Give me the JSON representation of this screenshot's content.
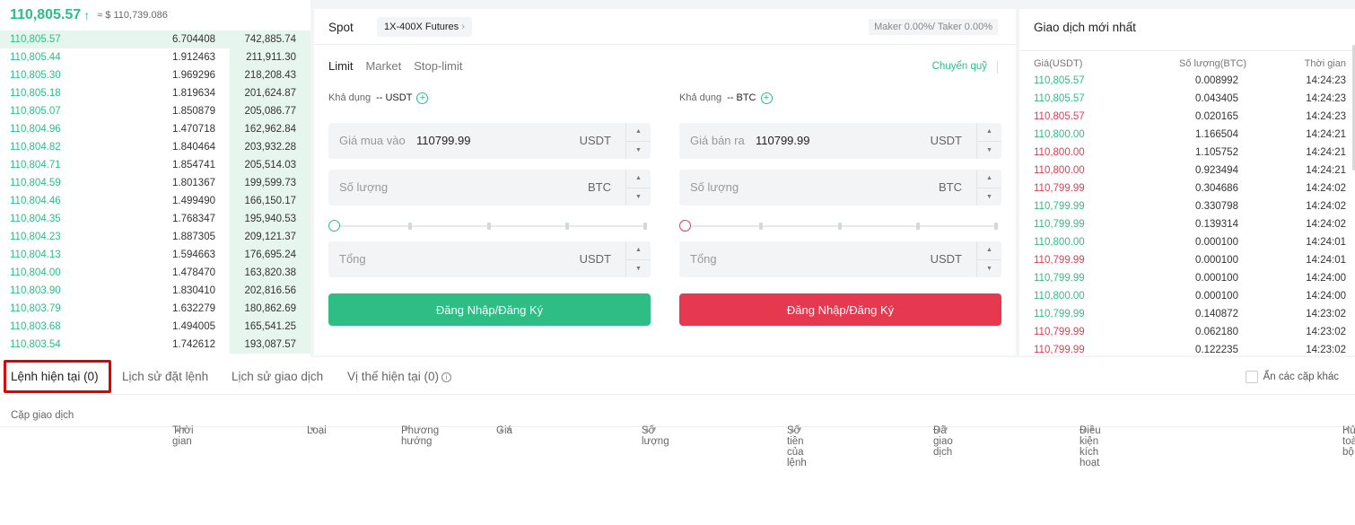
{
  "order_book": {
    "last_price": "110,805.57",
    "last_price_usd": "≈ $ 110,739.086",
    "rows": [
      {
        "price": "110,805.57",
        "amount": "6.704408",
        "total": "742,885.74"
      },
      {
        "price": "110,805.44",
        "amount": "1.912463",
        "total": "211,911.30"
      },
      {
        "price": "110,805.30",
        "amount": "1.969296",
        "total": "218,208.43"
      },
      {
        "price": "110,805.18",
        "amount": "1.819634",
        "total": "201,624.87"
      },
      {
        "price": "110,805.07",
        "amount": "1.850879",
        "total": "205,086.77"
      },
      {
        "price": "110,804.96",
        "amount": "1.470718",
        "total": "162,962.84"
      },
      {
        "price": "110,804.82",
        "amount": "1.840464",
        "total": "203,932.28"
      },
      {
        "price": "110,804.71",
        "amount": "1.854741",
        "total": "205,514.03"
      },
      {
        "price": "110,804.59",
        "amount": "1.801367",
        "total": "199,599.73"
      },
      {
        "price": "110,804.46",
        "amount": "1.499490",
        "total": "166,150.17"
      },
      {
        "price": "110,804.35",
        "amount": "1.768347",
        "total": "195,940.53"
      },
      {
        "price": "110,804.23",
        "amount": "1.887305",
        "total": "209,121.37"
      },
      {
        "price": "110,804.13",
        "amount": "1.594663",
        "total": "176,695.24"
      },
      {
        "price": "110,804.00",
        "amount": "1.478470",
        "total": "163,820.38"
      },
      {
        "price": "110,803.90",
        "amount": "1.830410",
        "total": "202,816.56"
      },
      {
        "price": "110,803.79",
        "amount": "1.632279",
        "total": "180,862.69"
      },
      {
        "price": "110,803.68",
        "amount": "1.494005",
        "total": "165,541.25"
      },
      {
        "price": "110,803.54",
        "amount": "1.742612",
        "total": "193,087.57"
      }
    ]
  },
  "trade_form": {
    "spot_label": "Spot",
    "futures_badge": "1X-400X Futures",
    "fees": "Maker 0.00%/ Taker 0.00%",
    "order_types": [
      "Limit",
      "Market",
      "Stop-limit"
    ],
    "convert_label": "Chuyển quỹ",
    "buy": {
      "available_label": "Khả dụng",
      "available_value": "-- USDT",
      "price_label": "Giá mua vào",
      "price_value": "110799.99",
      "price_unit": "USDT",
      "qty_label": "Số lượng",
      "qty_unit": "BTC",
      "total_label": "Tổng",
      "total_unit": "USDT",
      "button_label": "Đăng Nhập/Đăng Ký"
    },
    "sell": {
      "available_label": "Khả dụng",
      "available_value": "-- BTC",
      "price_label": "Giá bán ra",
      "price_value": "110799.99",
      "price_unit": "USDT",
      "qty_label": "Số lượng",
      "qty_unit": "BTC",
      "total_label": "Tổng",
      "total_unit": "USDT",
      "button_label": "Đăng Nhập/Đăng Ký"
    }
  },
  "recent_trades": {
    "title": "Giao dịch mới nhất",
    "col_price": "Giá(USDT)",
    "col_amount": "Số lượng(BTC)",
    "col_time": "Thời gian",
    "rows": [
      {
        "price": "110,805.57",
        "amount": "0.008992",
        "time": "14:24:23",
        "dir": "up"
      },
      {
        "price": "110,805.57",
        "amount": "0.043405",
        "time": "14:24:23",
        "dir": "up"
      },
      {
        "price": "110,805.57",
        "amount": "0.020165",
        "time": "14:24:23",
        "dir": "down"
      },
      {
        "price": "110,800.00",
        "amount": "1.166504",
        "time": "14:24:21",
        "dir": "up"
      },
      {
        "price": "110,800.00",
        "amount": "1.105752",
        "time": "14:24:21",
        "dir": "down"
      },
      {
        "price": "110,800.00",
        "amount": "0.923494",
        "time": "14:24:21",
        "dir": "down"
      },
      {
        "price": "110,799.99",
        "amount": "0.304686",
        "time": "14:24:02",
        "dir": "down"
      },
      {
        "price": "110,799.99",
        "amount": "0.330798",
        "time": "14:24:02",
        "dir": "up"
      },
      {
        "price": "110,799.99",
        "amount": "0.139314",
        "time": "14:24:02",
        "dir": "up"
      },
      {
        "price": "110,800.00",
        "amount": "0.000100",
        "time": "14:24:01",
        "dir": "up"
      },
      {
        "price": "110,799.99",
        "amount": "0.000100",
        "time": "14:24:01",
        "dir": "down"
      },
      {
        "price": "110,799.99",
        "amount": "0.000100",
        "time": "14:24:00",
        "dir": "up"
      },
      {
        "price": "110,800.00",
        "amount": "0.000100",
        "time": "14:24:00",
        "dir": "up"
      },
      {
        "price": "110,799.99",
        "amount": "0.140872",
        "time": "14:23:02",
        "dir": "up"
      },
      {
        "price": "110,799.99",
        "amount": "0.062180",
        "time": "14:23:02",
        "dir": "down"
      },
      {
        "price": "110,799.99",
        "amount": "0.122235",
        "time": "14:23:02",
        "dir": "down"
      }
    ]
  },
  "orders": {
    "tabs": [
      "Lệnh hiện tại (0)",
      "Lịch sử đặt lệnh",
      "Lịch sử giao dịch",
      "Vị thế hiện tại (0)"
    ],
    "hide_other_pairs": "Ẩn các cặp khác",
    "columns": [
      "Cặp giao dịch",
      "Thời gian",
      "Loại",
      "Phương hướng",
      "Giá",
      "Số lượng",
      "Số tiền của lệnh",
      "Đã giao dịch",
      "Điều kiện kích hoạt",
      "Hủy toàn bộ"
    ]
  },
  "colors": {
    "buy": "#2ebd85",
    "sell": "#e63950",
    "highlight": "#e00000"
  }
}
